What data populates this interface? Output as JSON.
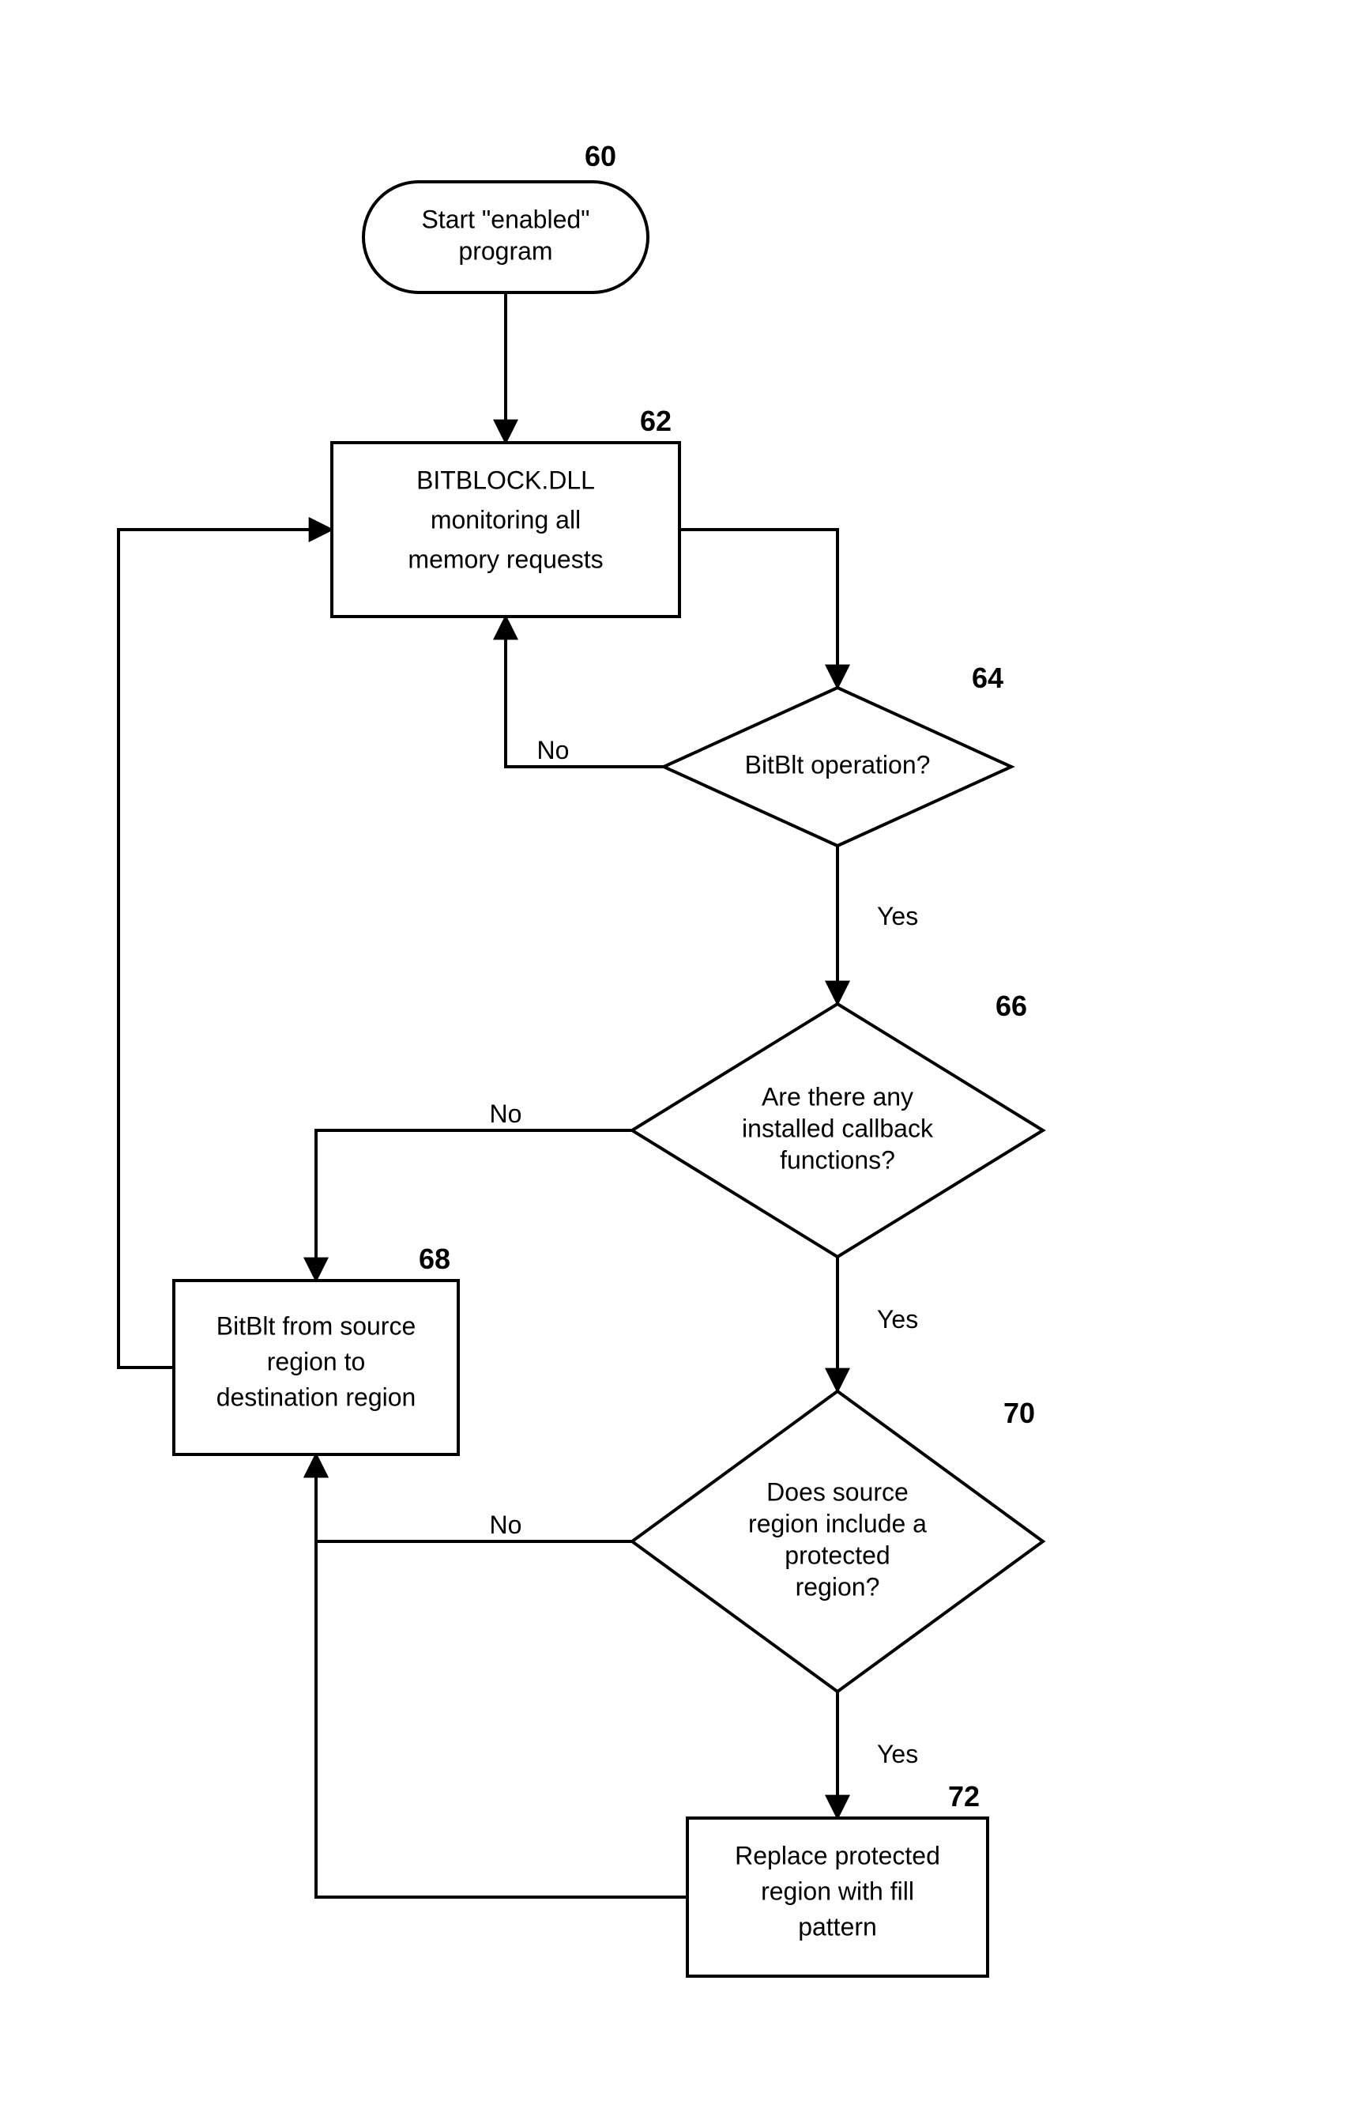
{
  "nodes": {
    "n60": {
      "ref": "60",
      "lines": [
        "Start \"enabled\"",
        "program"
      ]
    },
    "n62": {
      "ref": "62",
      "lines": [
        "BITBLOCK.DLL",
        "monitoring all",
        "memory requests"
      ]
    },
    "n64": {
      "ref": "64",
      "lines": [
        "BitBlt operation?"
      ]
    },
    "n66": {
      "ref": "66",
      "lines": [
        "Are there any",
        "installed callback",
        "functions?"
      ]
    },
    "n68": {
      "ref": "68",
      "lines": [
        "BitBlt from source",
        "region to",
        "destination region"
      ]
    },
    "n70": {
      "ref": "70",
      "lines": [
        "Does source",
        "region include a",
        "protected",
        "region?"
      ]
    },
    "n72": {
      "ref": "72",
      "lines": [
        "Replace protected",
        "region with fill",
        "pattern"
      ]
    }
  },
  "labels": {
    "l_64_no": "No",
    "l_64_yes": "Yes",
    "l_66_no": "No",
    "l_66_yes": "Yes",
    "l_70_no": "No",
    "l_70_yes": "Yes"
  }
}
